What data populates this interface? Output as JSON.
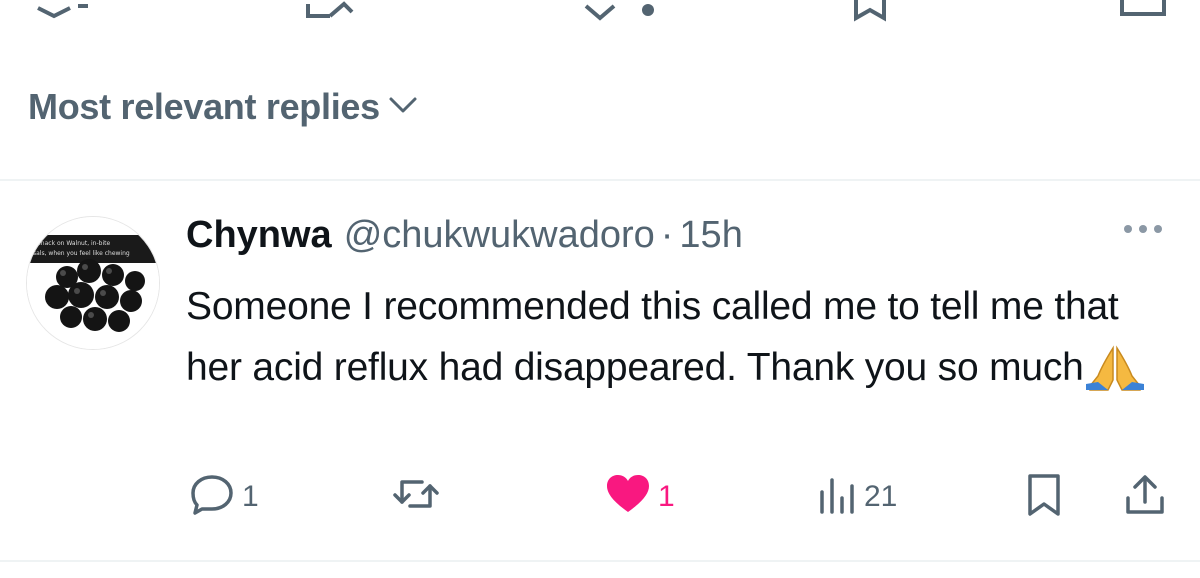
{
  "sort": {
    "label": "Most relevant replies",
    "chevron_icon": "chevron-down-icon"
  },
  "reply": {
    "display_name": "Chynwa",
    "handle": "@chukwukwadoro",
    "separator": "·",
    "time": "15h",
    "text": "Someone I recommended this called me to tell me that her acid reflux had disappeared. Thank you so much",
    "emoji_icon": "folded-hands-emoji",
    "avatar": {
      "caption_lines": [
        "Snack on Walnut, in-bite",
        "sals, when you feel like chewing"
      ],
      "icon": "walnut-photo-avatar"
    },
    "actions": {
      "reply_count": "1",
      "repost_count": "",
      "like_count": "1",
      "views_count": "21"
    }
  },
  "colors": {
    "text_primary": "#0f1419",
    "text_secondary": "#536471",
    "like_pink": "#f91880",
    "divider": "#eff3f4"
  }
}
